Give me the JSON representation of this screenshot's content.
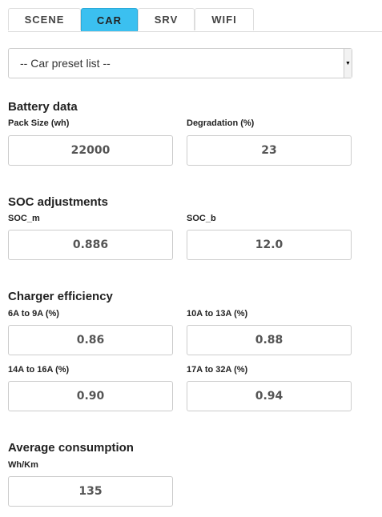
{
  "tabs": [
    {
      "label": "SCENE",
      "active": false
    },
    {
      "label": "CAR",
      "active": true
    },
    {
      "label": "SRV",
      "active": false
    },
    {
      "label": "WIFI",
      "active": false
    }
  ],
  "preset_select": {
    "value": "-- Car preset list --"
  },
  "battery": {
    "title": "Battery data",
    "pack_size": {
      "label": "Pack Size (wh)",
      "value": "22000"
    },
    "degradation": {
      "label": "Degradation (%)",
      "value": "23"
    }
  },
  "soc": {
    "title": "SOC adjustments",
    "soc_m": {
      "label": "SOC_m",
      "value": "0.886"
    },
    "soc_b": {
      "label": "SOC_b",
      "value": "12.0"
    }
  },
  "charger": {
    "title": "Charger efficiency",
    "eff_6_9": {
      "label": "6A to 9A (%)",
      "value": "0.86"
    },
    "eff_10_13": {
      "label": "10A to 13A (%)",
      "value": "0.88"
    },
    "eff_14_16": {
      "label": "14A to 16A (%)",
      "value": "0.90"
    },
    "eff_17_32": {
      "label": "17A to 32A (%)",
      "value": "0.94"
    }
  },
  "consumption": {
    "title": "Average consumption",
    "wh_km": {
      "label": "Wh/Km",
      "value": "135"
    }
  },
  "colors": {
    "active_tab": "#3bc0f0",
    "border": "#cccccc"
  }
}
